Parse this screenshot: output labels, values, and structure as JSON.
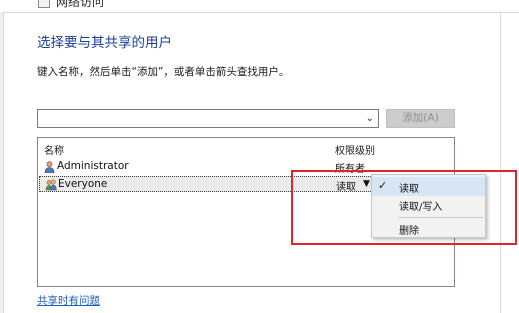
{
  "window": {
    "title": "网络访问"
  },
  "dialog": {
    "heading": "选择要与其共享的用户",
    "instruction": "键入名称，然后单击“添加”，或者单击箭头查找用户。",
    "add_button": "添加(A)",
    "combo_arrow_icon": "chevron-down-icon"
  },
  "list": {
    "columns": {
      "name": "名称",
      "permission": "权限级别"
    },
    "rows": [
      {
        "name": "Administrator",
        "permission": "所有者",
        "icon": "user-icon"
      },
      {
        "name": "Everyone",
        "permission": "读取",
        "icon": "group-icon",
        "selected": true
      }
    ]
  },
  "context_menu": {
    "items": [
      {
        "label": "读取",
        "checked": true
      },
      {
        "label": "读取/写入",
        "checked": false
      },
      {
        "label": "删除",
        "checked": false
      }
    ]
  },
  "help_link": "共享时有问题",
  "colors": {
    "heading": "#1d3f9a",
    "link": "#1d5fb8",
    "highlight": "#e1252b",
    "menu_checked": "#d7e6f5"
  }
}
